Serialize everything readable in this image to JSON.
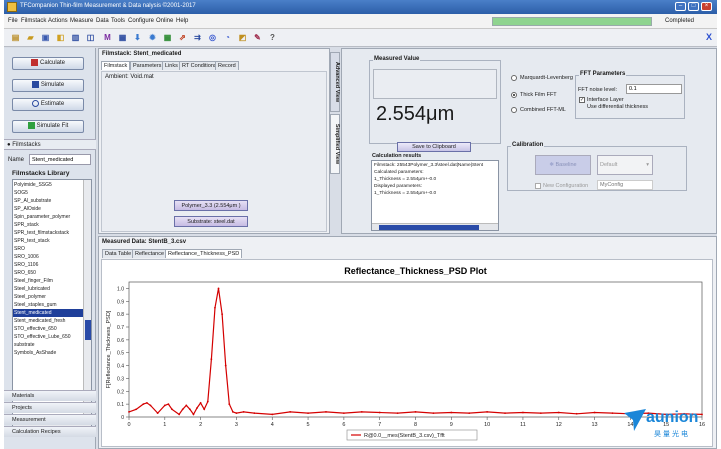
{
  "window": {
    "title": "TFCompanion Thin-film Measurement & Data nalysis ©2001-2017"
  },
  "menu": [
    "File",
    "Filmstack",
    "Actions",
    "Measure",
    "Data",
    "Tools",
    "Configure",
    "Online",
    "Help"
  ],
  "status": {
    "progress_label": "Completed",
    "progress": 1.0
  },
  "toolbar": {
    "close_glyph": "X"
  },
  "actions": {
    "calculate": "Calculate",
    "simulate": "Simulate",
    "estimate": "Estimate",
    "simulate_fit": "Simulate Fit"
  },
  "filmstacks": {
    "header": "Filmstacks",
    "name_label": "Name",
    "name_value": "Stent_medicated",
    "library_title": "Filmstacks Library",
    "items": [
      "Polyimide_SSG5",
      "SOG5",
      "SP_Al_substrate",
      "SP_AlOxide",
      "Spin_parameter_polymer",
      "SPR_stack",
      "SPR_test_filmstackstack",
      "SPR_test_stack",
      "SRO",
      "SRO_1006",
      "SRO_1106",
      "SRO_650",
      "Steel_finger_Film",
      "Steel_lubricated",
      "Steel_polymer",
      "Steel_staples_gum",
      "Stent_medicated",
      "Stent_medicated_fresh",
      "STO_effective_650",
      "STO_effective_Lube_650",
      "substrate",
      "Symbols_AsShade"
    ],
    "selected_index": 16
  },
  "bottom_nav": [
    "Materials",
    "Projects",
    "Measurement",
    "Calculation Recipes"
  ],
  "filmstack_panel": {
    "title": "Filmstack: Stent_medicated",
    "tabs": [
      "Filmstack",
      "Parameters",
      "Links",
      "RT Conditions",
      "Record"
    ],
    "ambient": "Ambient: Void.mat",
    "layer": "Polymer_3.3 (2.554μm )",
    "substrate": "Substrate: steel.dat",
    "side_tabs": [
      "Advanced View",
      "Simplified View"
    ]
  },
  "measured_value": {
    "title": "Measured Value",
    "value": "2.554μm",
    "clipboard_button": "Save to Clipboard",
    "calc_title": "Calculation results",
    "calc_lines": [
      "Filmstack: 25543Polymer_3.3\\steel.dat|Name|Stent",
      "Calculated parameters:",
      "1_Thickness = 2.554μm+-0.0",
      "Displayed parameters:",
      "1_Thickness = 2.554μm+-0.0"
    ]
  },
  "fft": {
    "methods": [
      "Marquardt-Levenberg",
      "Thick Film FFT",
      "Combined FFT-ML"
    ],
    "selected_method": 1,
    "title": "FFT Parameters",
    "noise_label": "FFT noise level:",
    "noise_value": "0.1",
    "interface_label": "Interface Layer",
    "differential_label": "Use differential thickness",
    "interface_checked": true
  },
  "calibration": {
    "title": "Calibration",
    "baseline_button": "Baseline",
    "default_select": "Default",
    "new_config_label": "New Configuration",
    "config_placeholder": "MyConfig"
  },
  "measured_data": {
    "title": "Measured Data: StentB_3.csv",
    "tabs": [
      "Data Table",
      "Reflectance",
      "Reflectance_Thickness_PSD"
    ],
    "active_tab": 2
  },
  "chart_data": {
    "type": "line",
    "title": "Reflectance_Thickness_PSD Plot",
    "xlabel": "Thickness [μm]",
    "ylabel": "F[Reflectance_Thickness_PSD]",
    "xlim": [
      0,
      16
    ],
    "ylim": [
      0,
      1.05
    ],
    "xticks": [
      0,
      1,
      2,
      3,
      4,
      5,
      6,
      7,
      8,
      9,
      10,
      11,
      12,
      13,
      14,
      15,
      16
    ],
    "yticks": [
      0,
      0.1,
      0.2,
      0.3,
      0.4,
      0.5,
      0.6,
      0.7,
      0.8,
      0.9,
      1.0
    ],
    "grid": false,
    "legend": "bottom-center",
    "series": [
      {
        "name": "R@0.0__mes(StentB_3.csv)_Tfft",
        "color": "#d40000",
        "x": [
          0.0,
          0.2,
          0.4,
          0.5,
          0.6,
          0.8,
          1.0,
          1.1,
          1.2,
          1.4,
          1.5,
          1.6,
          1.7,
          1.8,
          1.9,
          2.0,
          2.1,
          2.2,
          2.3,
          2.4,
          2.5,
          2.6,
          2.7,
          2.8,
          2.9,
          3.0,
          3.2,
          3.5,
          4.0,
          4.5,
          5.0,
          5.5,
          6.0,
          6.5,
          7.0,
          7.5,
          8.0,
          8.5,
          9.0,
          9.5,
          10.0,
          10.5,
          11.0,
          11.5,
          12.0,
          12.5,
          13.0,
          13.5,
          14.0,
          14.5,
          15.0,
          15.5,
          16.0
        ],
        "y": [
          0.04,
          0.06,
          0.1,
          0.11,
          0.09,
          0.03,
          0.09,
          0.1,
          0.06,
          0.02,
          0.06,
          0.09,
          0.06,
          0.02,
          0.07,
          0.11,
          0.06,
          0.12,
          0.45,
          0.85,
          1.0,
          0.8,
          0.4,
          0.1,
          0.04,
          0.03,
          0.04,
          0.03,
          0.02,
          0.04,
          0.03,
          0.04,
          0.03,
          0.04,
          0.035,
          0.03,
          0.04,
          0.03,
          0.035,
          0.03,
          0.04,
          0.03,
          0.035,
          0.03,
          0.035,
          0.025,
          0.035,
          0.03,
          0.025,
          0.03,
          0.02,
          0.025,
          0.02
        ]
      }
    ]
  },
  "logo": {
    "word": "aunion",
    "sub": "昊量光电",
    "color": "#1a86d8"
  }
}
